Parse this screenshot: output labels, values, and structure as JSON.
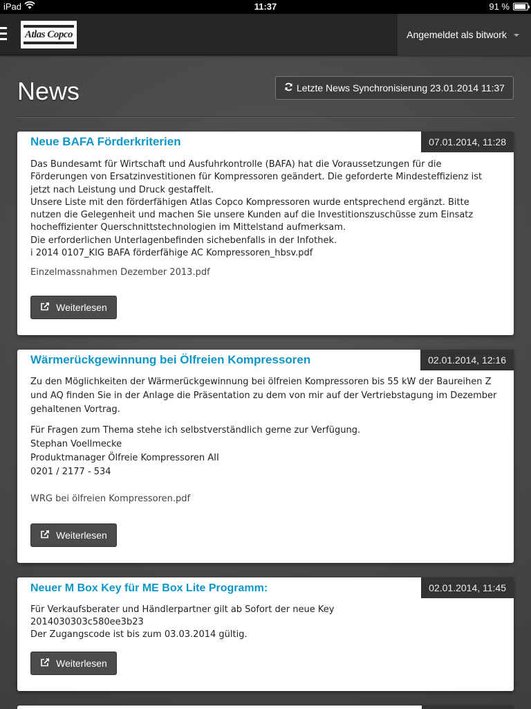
{
  "status_bar": {
    "device": "iPad",
    "time": "11:37",
    "battery": "91 %",
    "battery_level": 0.91
  },
  "header": {
    "logo_text": "Atlas Copco",
    "user_label": "Angemeldet als bitwork"
  },
  "page": {
    "title": "News",
    "sync_label": "Letzte News Synchronisierung 23.01.2014 11:37"
  },
  "news": [
    {
      "title": "Neue BAFA Förderkriterien",
      "date": "07.01.2014, 11:28",
      "lines": [
        "Das Bundesamt für Wirtschaft und Ausfuhrkontrolle (BAFA) hat die Voraussetzungen für die",
        "Förderungen von Ersatzinvestitionen für Kompressoren geändert. Die geforderte Mindesteffizienz ist",
        "jetzt nach Leistung und Druck gestaffelt.",
        "Unsere Liste mit den förderfähigen Atlas Copco Kompressoren wurde entsprechend ergänzt. Bitte",
        "nutzen die Gelegenheit und machen Sie unsere Kunden auf die Investitionszuschüsse zum Einsatz",
        "hocheffizienter Querschnittstechnologien im Mittelstand aufmerksam.",
        "Die erforderlichen Unterlagenbefinden sichebenfalls in der Infothek.",
        "i 2014 0107_KIG BAFA förderfähige AC Kompressoren_hbsv.pdf"
      ],
      "attachment": "Einzelmassnahmen Dezember 2013.pdf",
      "button": "Weiterlesen"
    },
    {
      "title": "Wärmerückgewinnung bei Ölfreien Kompressoren",
      "date": "02.01.2014, 12:16",
      "lines": [
        "Zu den Möglichkeiten der Wärmerückgewinnung bei ölfreien Kompressoren bis 55 kW der Baureihen Z",
        "und AQ finden Sie in der Anlage die Präsentation zu dem von mir auf der Vertriebstagung im Dezember",
        "gehaltenen Vortrag.",
        "Für Fragen zum Thema stehe ich selbstverständlich gerne zur Verfügung.",
        "Stephan Voellmecke",
        "Produktmanager Ölfreie Kompressoren AII",
        "0201 / 2177 - 534"
      ],
      "attachment": "WRG bei ölfreien Kompressoren.pdf",
      "button": "Weiterlesen"
    },
    {
      "title": "Neuer M Box Key für ME Box Lite Programm:",
      "date": "02.01.2014, 11:45",
      "lines": [
        "Für Verkaufsberater und Händlerpartner gilt ab Sofort der neue Key",
        "2014030303c580ee3b23",
        "Der Zugangscode ist bis zum 03.03.2014 gültig."
      ],
      "button": "Weiterlesen"
    }
  ]
}
